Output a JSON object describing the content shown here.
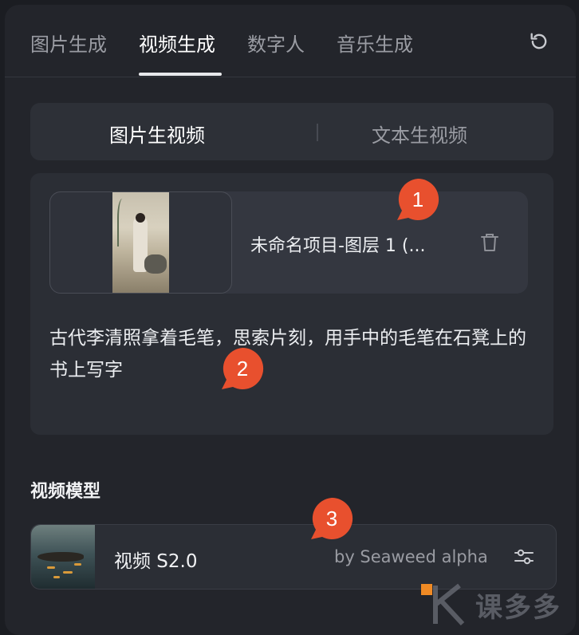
{
  "tabs": [
    {
      "label": "图片生成"
    },
    {
      "label": "视频生成"
    },
    {
      "label": "数字人"
    },
    {
      "label": "音乐生成"
    }
  ],
  "active_tab": "视频生成",
  "segmented": {
    "items": [
      {
        "label": "图片生视频"
      },
      {
        "label": "文本生视频"
      }
    ],
    "active": "图片生视频"
  },
  "upload": {
    "file_name": "未命名项目-图层 1 (..."
  },
  "prompt": {
    "text": "古代李清照拿着毛笔，思索片刻，用手中的毛笔在石凳上的书上写字"
  },
  "model_section": {
    "title": "视频模型",
    "model_name": "视频 S2.0",
    "model_by": "by Seaweed alpha"
  },
  "markers": [
    "1",
    "2",
    "3"
  ],
  "watermark": {
    "text": "课多多"
  },
  "colors": {
    "marker": "#e8502e",
    "background": "#1b1d22",
    "panel": "#23252b",
    "card": "#2b2e35"
  }
}
